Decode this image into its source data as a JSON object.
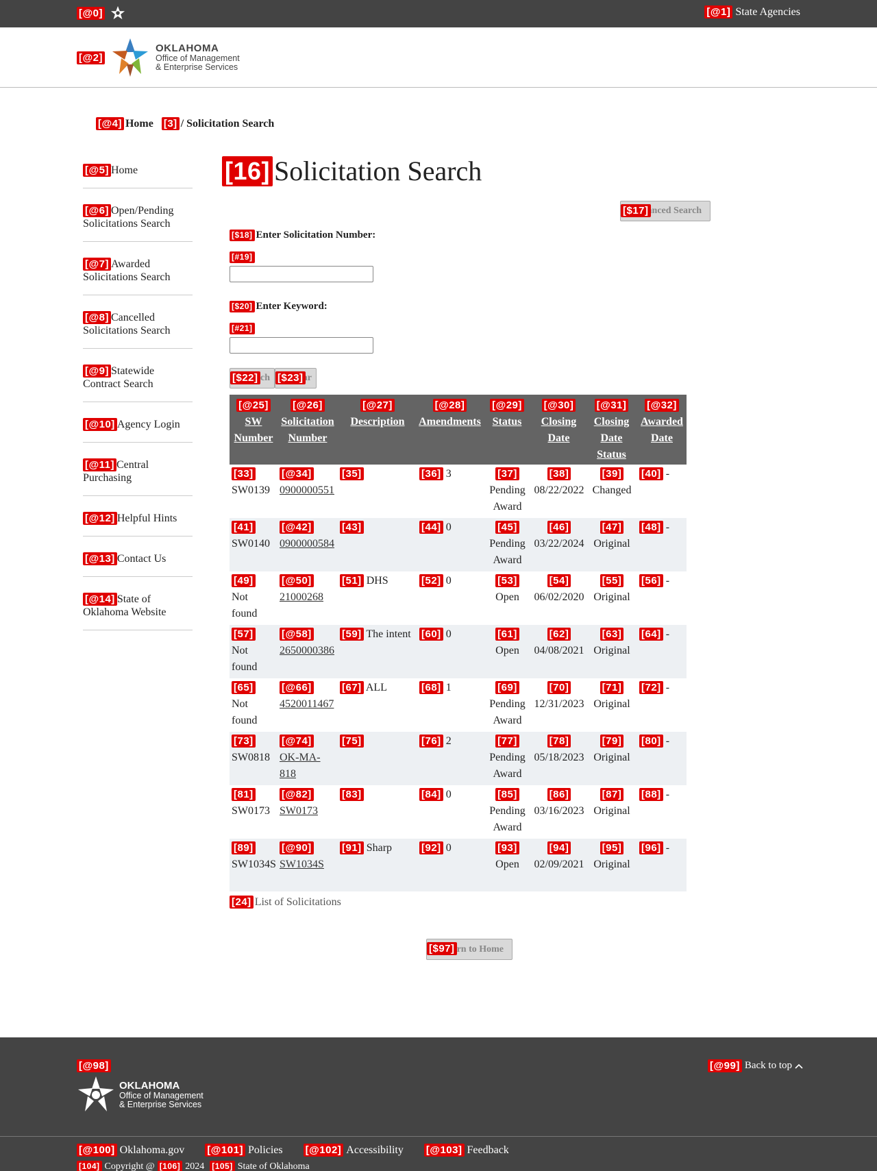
{
  "topbar": {
    "tag0": "[@0]",
    "tag1": "[@1]",
    "agencies": "State Agencies"
  },
  "header": {
    "tag2": "[@2]",
    "logo_line1": "OKLAHOMA",
    "logo_line2": "Office of Management",
    "logo_line3": "& Enterprise Services"
  },
  "breadcrumb": {
    "tag4": "[@4]",
    "home": "Home",
    "tag3": "[3]",
    "current": "/ Solicitation Search"
  },
  "sidebar": {
    "items": [
      {
        "tag": "[@5]",
        "label": "Home"
      },
      {
        "tag": "[@6]",
        "label": "Open/Pending Solicitations Search"
      },
      {
        "tag": "[@7]",
        "label": "Awarded Solicitations Search"
      },
      {
        "tag": "[@8]",
        "label": "Cancelled Solicitations Search"
      },
      {
        "tag": "[@9]",
        "label": "Statewide Contract Search"
      },
      {
        "tag": "[@10]",
        "label": "Agency Login"
      },
      {
        "tag": "[@11]",
        "label": "Central Purchasing"
      },
      {
        "tag": "[@12]",
        "label": "Helpful Hints"
      },
      {
        "tag": "[@13]",
        "label": "Contact Us"
      },
      {
        "tag": "[@14]",
        "label": "State of Oklahoma Website"
      }
    ]
  },
  "main": {
    "title_tag": "[16]",
    "title": "Solicitation Search",
    "advanced_tag": "[$17]",
    "advanced_label": "Advanced Search",
    "sol_num_tag": "[$18]",
    "sol_num_label": "Enter Solicitation Number:",
    "sol_num_input_tag": "[#19]",
    "sol_num_value": "",
    "keyword_tag": "[$20]",
    "keyword_label": "Enter Keyword:",
    "keyword_input_tag": "[#21]",
    "keyword_value": "",
    "search_tag": "[$22]",
    "search_label": "Search",
    "clear_tag": "[$23]",
    "clear_label": "Clear",
    "list_tag": "[24]",
    "list_caption": "List of Solicitations",
    "home_tag": "[$97]",
    "home_label": "Return to Home"
  },
  "table": {
    "headers": [
      {
        "tag": "[@25]",
        "label": "SW Number"
      },
      {
        "tag": "[@26]",
        "label": "Solicitation Number"
      },
      {
        "tag": "[@27]",
        "label": "Description"
      },
      {
        "tag": "[@28]",
        "label": "Amendments"
      },
      {
        "tag": "[@29]",
        "label": "Status"
      },
      {
        "tag": "[@30]",
        "label": "Closing Date"
      },
      {
        "tag": "[@31]",
        "label": "Closing Date Status"
      },
      {
        "tag": "[@32]",
        "label": "Awarded Date"
      }
    ],
    "rows": [
      {
        "tags": [
          "[33]",
          "[@34]",
          "[35]",
          "[36]",
          "[37]",
          "[38]",
          "[39]",
          "[40]"
        ],
        "sw": "SW0139",
        "sol": "0900000551",
        "desc": "",
        "amend": "3",
        "status": "Pending Award",
        "closing": "08/22/2022",
        "cstatus": "Changed",
        "awarded": "-"
      },
      {
        "tags": [
          "[41]",
          "[@42]",
          "[43]",
          "[44]",
          "[45]",
          "[46]",
          "[47]",
          "[48]"
        ],
        "sw": "SW0140",
        "sol": "0900000584",
        "desc": "",
        "amend": "0",
        "status": "Pending Award",
        "closing": "03/22/2024",
        "cstatus": "Original",
        "awarded": "-"
      },
      {
        "tags": [
          "[49]",
          "[@50]",
          "[51]",
          "[52]",
          "[53]",
          "[54]",
          "[55]",
          "[56]"
        ],
        "sw": "Not found",
        "sol": "21000268",
        "desc": "DHS",
        "amend": "0",
        "status": "Open",
        "closing": "06/02/2020",
        "cstatus": "Original",
        "awarded": "-"
      },
      {
        "tags": [
          "[57]",
          "[@58]",
          "[59]",
          "[60]",
          "[61]",
          "[62]",
          "[63]",
          "[64]"
        ],
        "sw": "Not found",
        "sol": "2650000386",
        "desc": "The intent",
        "amend": "0",
        "status": "Open",
        "closing": "04/08/2021",
        "cstatus": "Original",
        "awarded": "-"
      },
      {
        "tags": [
          "[65]",
          "[@66]",
          "[67]",
          "[68]",
          "[69]",
          "[70]",
          "[71]",
          "[72]"
        ],
        "sw": "Not found",
        "sol": "4520011467",
        "desc": "ALL",
        "amend": "1",
        "status": "Pending Award",
        "closing": "12/31/2023",
        "cstatus": "Original",
        "awarded": "-"
      },
      {
        "tags": [
          "[73]",
          "[@74]",
          "[75]",
          "[76]",
          "[77]",
          "[78]",
          "[79]",
          "[80]"
        ],
        "sw": "SW0818",
        "sol": "OK-MA-818",
        "desc": "",
        "amend": "2",
        "status": "Pending Award",
        "closing": "05/18/2023",
        "cstatus": "Original",
        "awarded": "-"
      },
      {
        "tags": [
          "[81]",
          "[@82]",
          "[83]",
          "[84]",
          "[85]",
          "[86]",
          "[87]",
          "[88]"
        ],
        "sw": "SW0173",
        "sol": "SW0173",
        "desc": "",
        "amend": "0",
        "status": "Pending Award",
        "closing": "03/16/2023",
        "cstatus": "Original",
        "awarded": "-"
      },
      {
        "tags": [
          "[89]",
          "[@90]",
          "[91]",
          "[92]",
          "[93]",
          "[94]",
          "[95]",
          "[96]"
        ],
        "sw": "SW1034S",
        "sol": "SW1034S",
        "desc": "Sharp",
        "amend": "0",
        "status": "Open",
        "closing": "02/09/2021",
        "cstatus": "Original",
        "awarded": "-"
      }
    ]
  },
  "footer": {
    "logo_tag": "[@98]",
    "logo_line1": "OKLAHOMA",
    "logo_line2": "Office of Management",
    "logo_line3": "& Enterprise Services",
    "back_tag": "[@99]",
    "back_label": "Back to top",
    "links": [
      {
        "tag": "[@100]",
        "label": "Oklahoma.gov"
      },
      {
        "tag": "[@101]",
        "label": "Policies"
      },
      {
        "tag": "[@102]",
        "label": "Accessibility"
      },
      {
        "tag": "[@103]",
        "label": "Feedback"
      }
    ],
    "copy_tag": "[104]",
    "copy_text": "Copyright @",
    "year_tag": "[106]",
    "year": "2024",
    "state_tag": "[105]",
    "state": "State of Oklahoma"
  },
  "colors": {
    "topbar": "#444444",
    "header_row": "#646464",
    "alt_row": "#edf0f3",
    "tag": "#e00000"
  }
}
